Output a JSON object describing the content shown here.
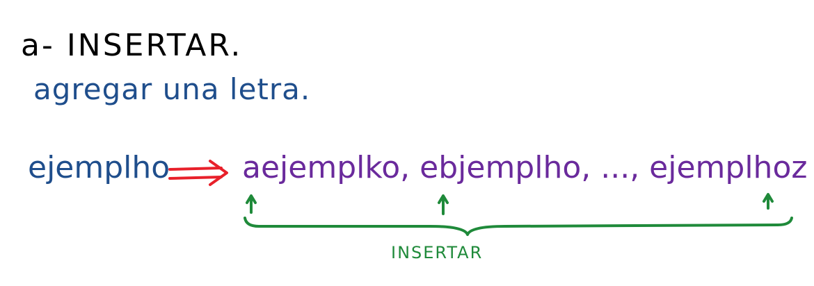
{
  "heading": "a- INSERTAR.",
  "subheading": "agregar una letra.",
  "example": {
    "source_word": "ejemplho",
    "results": "aejemplko, ebjemplho, ..., ejemplhoz",
    "brace_label": "INSERTAR"
  },
  "colors": {
    "heading": "#000000",
    "subheading": "#1f4e8c",
    "source_word": "#1f4e8c",
    "arrow": "#e8202a",
    "results": "#6a2a9c",
    "brace": "#1f8a3a",
    "brace_label": "#1f8a3a"
  },
  "icons": {
    "implication_arrow": "double-right-arrow-icon",
    "insertion_markers": "up-arrow-icon"
  }
}
